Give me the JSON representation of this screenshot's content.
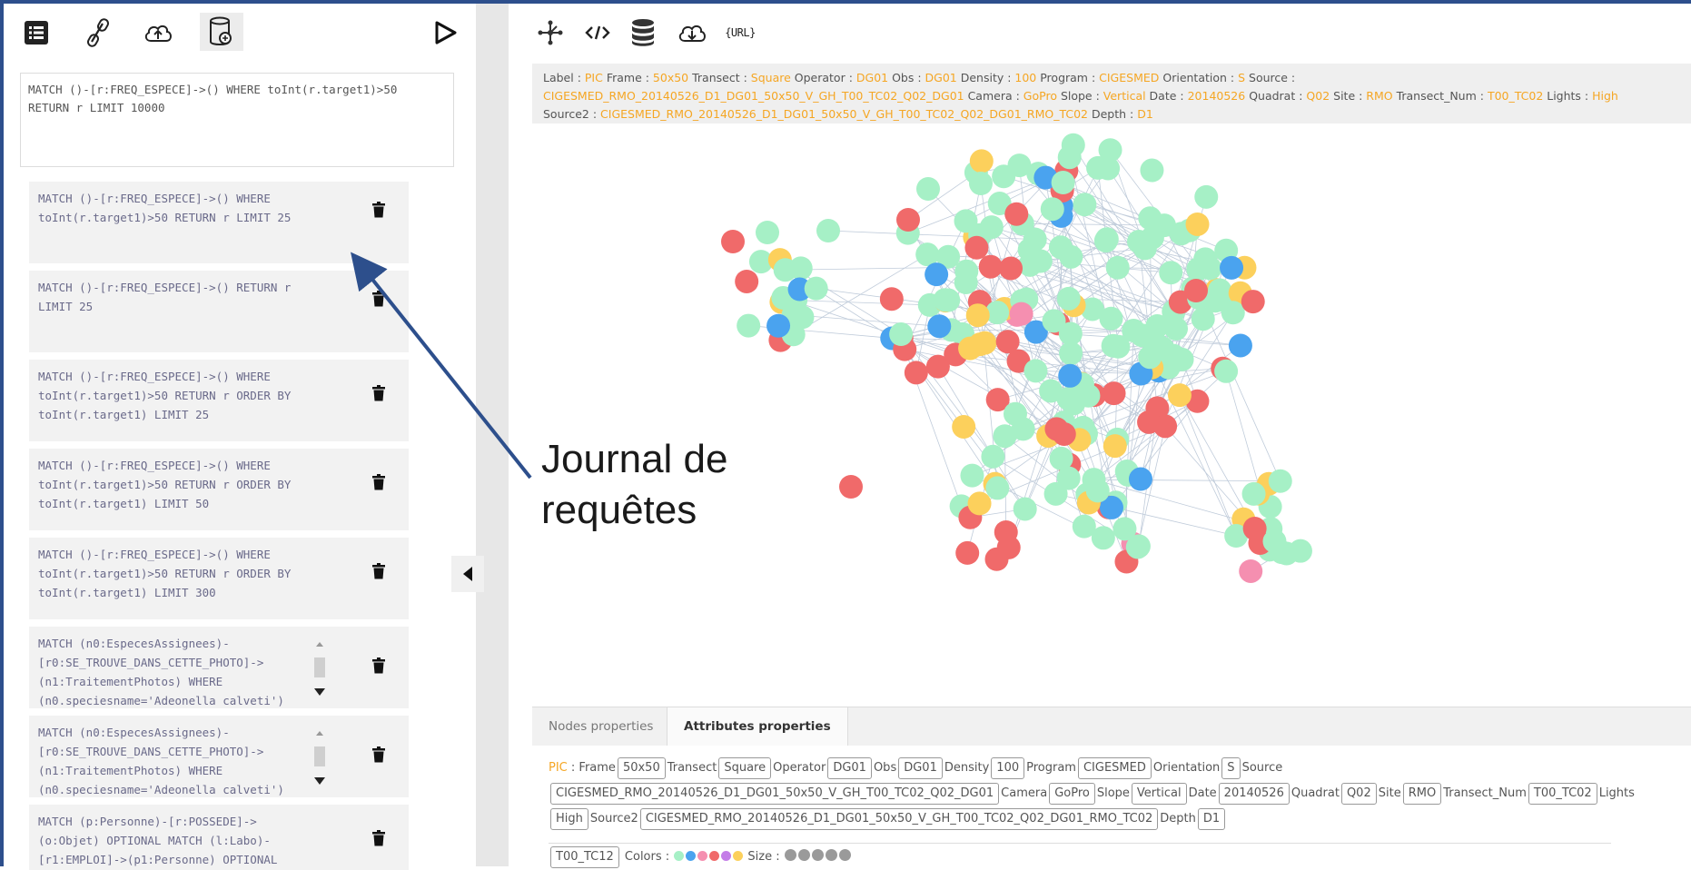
{
  "left_toolbar": {
    "icons": [
      "list-icon",
      "link-icon",
      "cloud-upload-icon",
      "database-settings-icon",
      "play-icon"
    ]
  },
  "query_input": "MATCH ()-[r:FREQ_ESPECE]->() WHERE toInt(r.target1)>50\nRETURN r LIMIT 10000",
  "query_history": [
    "MATCH ()-[r:FREQ_ESPECE]->() WHERE\ntoInt(r.target1)>50 RETURN r LIMIT 25",
    "MATCH ()-[r:FREQ_ESPECE]->() RETURN r\nLIMIT 25",
    "MATCH ()-[r:FREQ_ESPECE]->() WHERE\ntoInt(r.target1)>50 RETURN r ORDER BY\ntoInt(r.target1) LIMIT 25",
    "MATCH ()-[r:FREQ_ESPECE]->() WHERE\ntoInt(r.target1)>50 RETURN r ORDER BY\ntoInt(r.target1) LIMIT 50",
    "MATCH ()-[r:FREQ_ESPECE]->() WHERE\ntoInt(r.target1)>50 RETURN r ORDER BY\ntoInt(r.target1) LIMIT 300",
    "MATCH (n0:EspecesAssignees)-\n[r0:SE_TROUVE_DANS_CETTE_PHOTO]->\n(n1:TraitementPhotos) WHERE\n(n0.speciesname='Adeonella calveti')",
    "MATCH (n0:EspecesAssignees)-\n[r0:SE_TROUVE_DANS_CETTE_PHOTO]->\n(n1:TraitementPhotos) WHERE\n(n0.speciesname='Adeonella calveti')",
    "MATCH (p:Personne)-[r:POSSEDE]->\n(o:Objet) OPTIONAL MATCH (l:Labo)-\n[r1:EMPLOI]->(p1:Personne) OPTIONAL"
  ],
  "right_toolbar": {
    "icons": [
      "graph-layout-icon",
      "code-icon",
      "database-icon",
      "cloud-download-icon",
      "url-icon"
    ],
    "url_label": "{URL}"
  },
  "info": {
    "label_key": "Label : ",
    "label_val": "PIC",
    "frame_key": " Frame : ",
    "frame_val": "50x50",
    "transect_key": " Transect : ",
    "transect_val": "Square",
    "operator_key": " Operator : ",
    "operator_val": "DG01",
    "obs_key": " Obs : ",
    "obs_val": "DG01",
    "density_key": " Density : ",
    "density_val": "100",
    "program_key": " Program : ",
    "program_val": "CIGESMED",
    "orientation_key": " Orientation : ",
    "orientation_val": "S",
    "source_key": " Source :",
    "source_val": "CIGESMED_RMO_20140526_D1_DG01_50x50_V_GH_T00_TC02_Q02_DG01",
    "camera_key": " Camera : ",
    "camera_val": "GoPro",
    "slope_key": " Slope : ",
    "slope_val": "Vertical",
    "date_key": " Date : ",
    "date_val": "20140526",
    "quadrat_key": " Quadrat : ",
    "quadrat_val": "Q02",
    "site_key": " Site : ",
    "site_val": "RMO",
    "transectnum_key": " Transect_Num : ",
    "transectnum_val": "T00_TC02",
    "lights_key": " Lights : ",
    "lights_val": "High",
    "source2_key": "Source2 : ",
    "source2_val": "CIGESMED_RMO_20140526_D1_DG01_50x50_V_GH_T00_TC02_Q02_DG01_RMO_TC02",
    "depth_key": " Depth : ",
    "depth_val": "D1"
  },
  "graph": {
    "node_colors": [
      "#a6f0c6",
      "#f06a6a",
      "#fcd05c",
      "#4aa3ef",
      "#f58fb0"
    ]
  },
  "tabs": [
    "Nodes properties",
    "Attributes properties"
  ],
  "attributes": {
    "label_val": "PIC",
    "label_sep": " : ",
    "pairs_line1": [
      [
        "Frame",
        "50x50"
      ],
      [
        "Transect",
        "Square"
      ],
      [
        "Operator",
        "DG01"
      ],
      [
        "Obs",
        "DG01"
      ],
      [
        "Density",
        "100"
      ],
      [
        "Program",
        "CIGESMED"
      ],
      [
        "Orientation",
        "S"
      ]
    ],
    "source_key": "Source",
    "source_val": "CIGESMED_RMO_20140526_D1_DG01_50x50_V_GH_T00_TC02_Q02_DG01",
    "pairs_line2": [
      [
        "Camera",
        "GoPro"
      ],
      [
        "Slope",
        "Vertical"
      ],
      [
        "Date",
        "20140526"
      ],
      [
        "Quadrat",
        "Q02"
      ],
      [
        "Site",
        "RMO"
      ],
      [
        "Transect_Num",
        "T00_TC02"
      ]
    ],
    "lights_key": "Lights",
    "lights_val": "High",
    "source2_key": "Source2",
    "source2_val": "CIGESMED_RMO_20140526_D1_DG01_50x50_V_GH_T00_TC02_Q02_DG01_RMO_TC02",
    "depth_key": "Depth",
    "depth_val": "D1"
  },
  "footer": {
    "tag": "T00_TC12",
    "colors_label": "Colors : ",
    "colors": [
      "#a6f0c6",
      "#4aa3ef",
      "#f58fb0",
      "#f06a6a",
      "#c47de8",
      "#fcd05c"
    ],
    "size_label": " Size : ",
    "size_dots": [
      "#9a9a9a",
      "#9a9a9a",
      "#9a9a9a",
      "#9a9a9a",
      "#9a9a9a"
    ]
  },
  "annotation": {
    "line1": "Journal de",
    "line2": "requêtes"
  }
}
